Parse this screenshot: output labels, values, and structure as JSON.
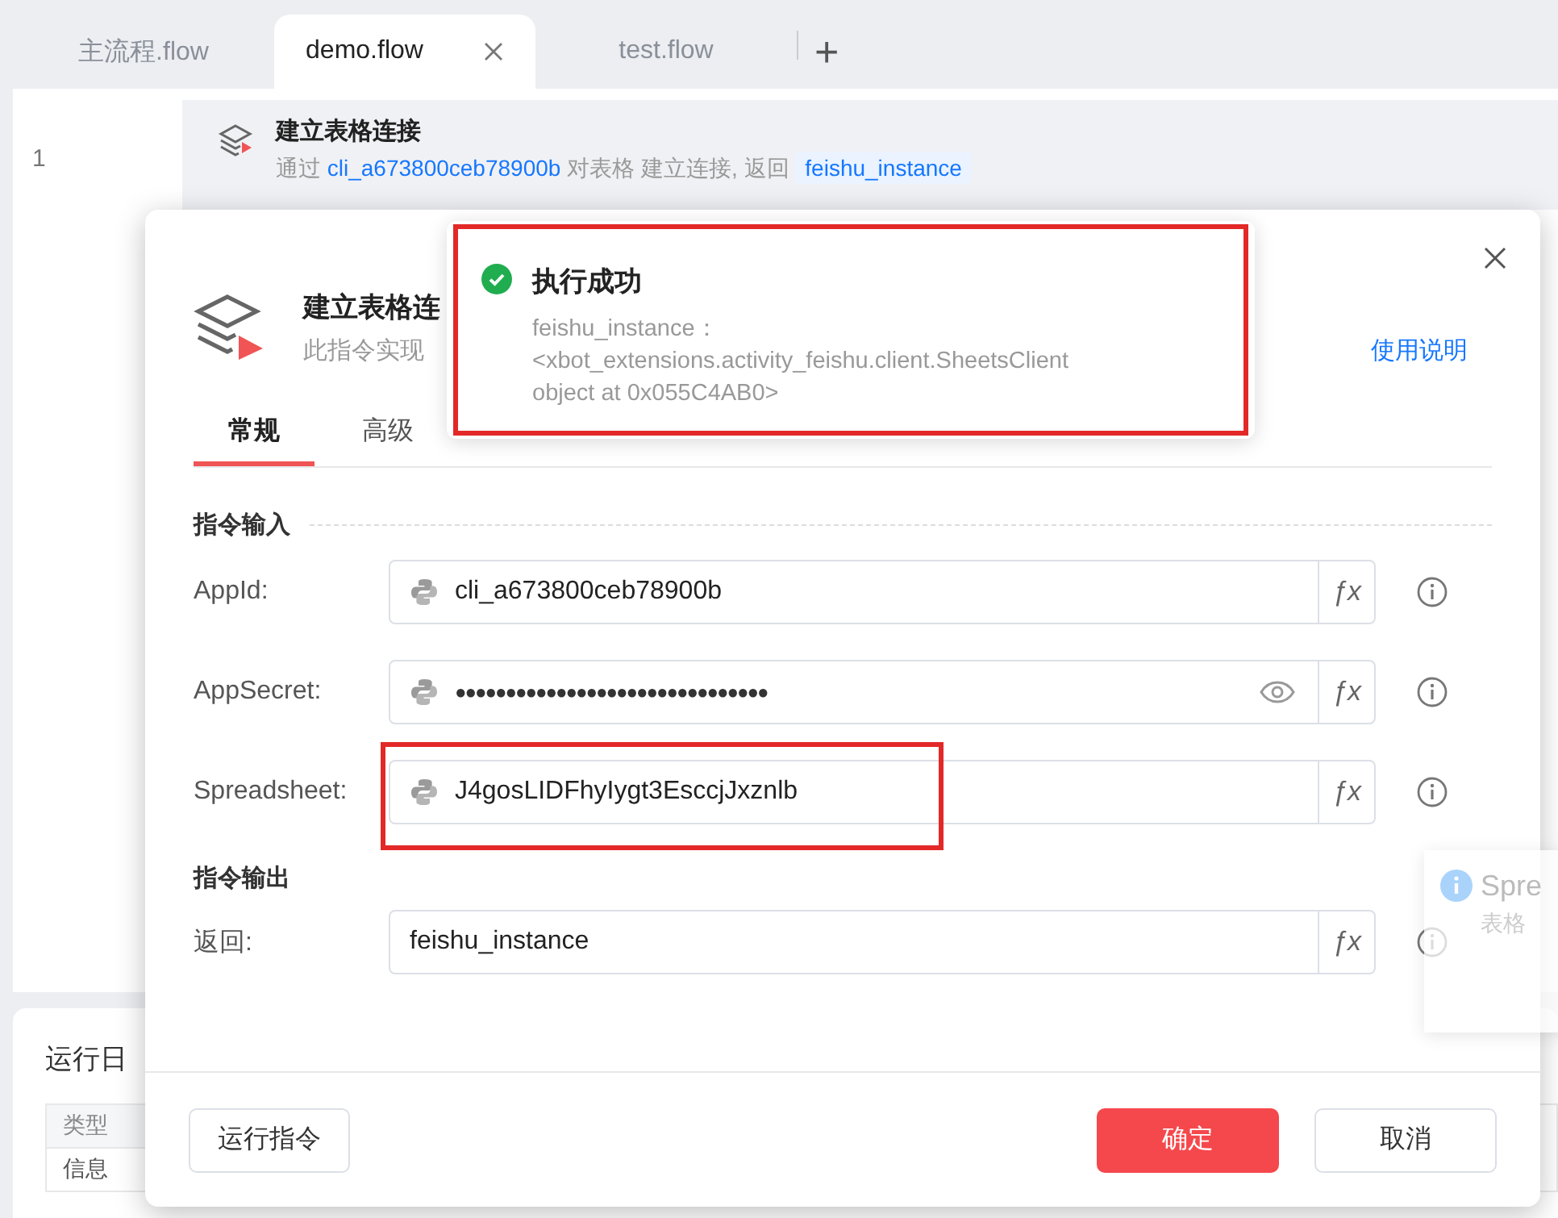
{
  "tabs": [
    {
      "label": "主流程.flow",
      "selected": false,
      "closable": false
    },
    {
      "label": "demo.flow",
      "selected": true,
      "closable": true
    },
    {
      "label": "test.flow",
      "selected": false,
      "closable": false
    }
  ],
  "new_tab": "+",
  "editor": {
    "line_number": "1",
    "step": {
      "title": "建立表格连接",
      "prefix": "通过 ",
      "app_id": "cli_a673800ceb78900b",
      "middle": " 对表格  建立连接, 返回 ",
      "output": "feishu_instance"
    }
  },
  "log_panel": {
    "title": "运行日",
    "columns": [
      "类型"
    ],
    "rows": [
      "信息"
    ]
  },
  "dialog": {
    "title": "建立表格连",
    "subtitle": "此指令实现",
    "help_link": "使用说明",
    "tabs": [
      {
        "label": "常规",
        "selected": true
      },
      {
        "label": "高级",
        "selected": false
      }
    ],
    "input_section": "指令输入",
    "inputs": [
      {
        "label": "AppId:",
        "value": "cli_a673800ceb78900b",
        "kind": "python",
        "fx": "ƒx",
        "highlighted": false
      },
      {
        "label": "AppSecret:",
        "value": "●●●●●●●●●●●●●●●●●●●●●●●●●●●●●●●",
        "kind": "secret",
        "fx": "ƒx",
        "highlighted": false
      },
      {
        "label": "Spreadsheet:",
        "value": "J4gosLIDFhyIygt3EsccjJxznlb",
        "kind": "python",
        "fx": "ƒx",
        "highlighted": true
      }
    ],
    "output_section": "指令输出",
    "output": {
      "label": "返回:",
      "value": "feishu_instance",
      "fx": "ƒx"
    },
    "run_button": "运行指令",
    "ok_button": "确定",
    "cancel_button": "取消"
  },
  "toast": {
    "title": "执行成功",
    "lines": [
      "feishu_instance：",
      "<xbot_extensions.activity_feishu.client.SheetsClient",
      "object at 0x055C4AB0>"
    ],
    "highlighted": true
  },
  "notification": {
    "title": "Spre",
    "text": "表格"
  }
}
